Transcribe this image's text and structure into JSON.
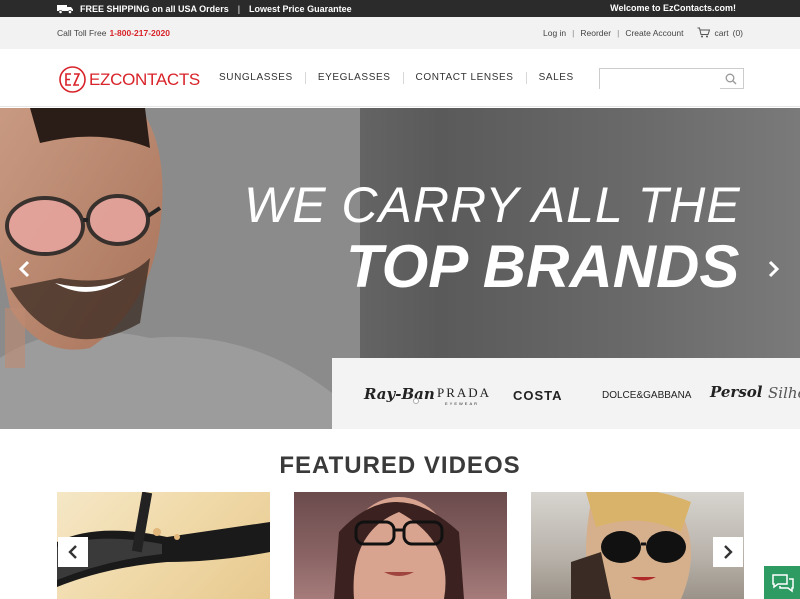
{
  "promo": {
    "shipping": "FREE SHIPPING on all USA Orders",
    "separator": "|",
    "guarantee": "Lowest Price Guarantee",
    "welcome": "Welcome to EzContacts.com!"
  },
  "util": {
    "phone_label": "Call Toll Free",
    "phone_number": "1-800-217-2020",
    "login": "Log in",
    "reorder": "Reorder",
    "create_account": "Create Account",
    "cart": "cart",
    "cart_count": "(0)",
    "pipe": "|"
  },
  "logo": {
    "text": "EZCONTACTS"
  },
  "nav": {
    "items": [
      "SUNGLASSES",
      "EYEGLASSES",
      "CONTACT LENSES",
      "SALES"
    ]
  },
  "search": {
    "placeholder": "",
    "value": ""
  },
  "hero": {
    "line1": "WE CARRY ALL THE",
    "line2": "TOP BRANDS",
    "brands": [
      "Ray-Ban",
      "PRADA",
      "COSTA",
      "DOLCE&GABBANA",
      "Persol",
      "Silhouette"
    ],
    "brand_sub": "EYEWEAR"
  },
  "featured": {
    "title": "FEATURED VIDEOS"
  },
  "colors": {
    "brand_red": "#d8232a",
    "promo_bg": "#2b2b2b",
    "chat_green": "#2e9b63"
  }
}
